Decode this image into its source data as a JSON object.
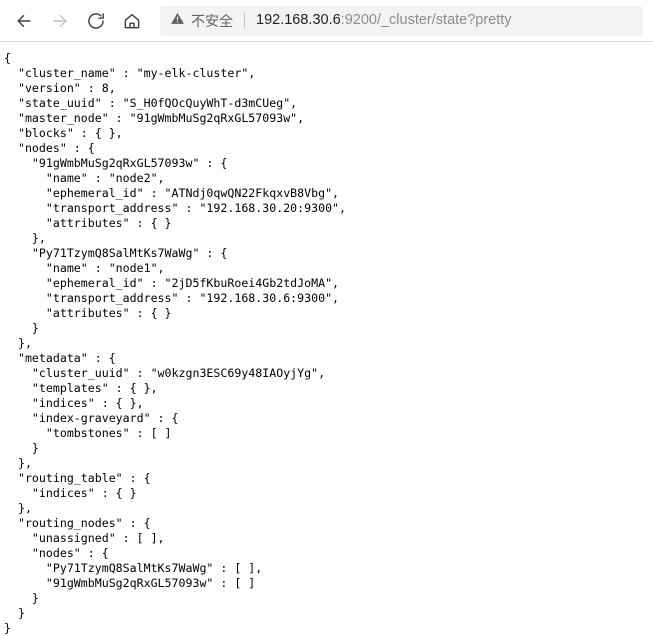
{
  "browser": {
    "nav": {
      "back_label": "Back",
      "back_icon": "arrow-left-icon",
      "forward_label": "Forward",
      "forward_icon": "arrow-right-icon",
      "reload_label": "Reload",
      "reload_icon": "reload-icon",
      "home_label": "Home",
      "home_icon": "home-icon"
    },
    "omnibox": {
      "security_icon": "warning-triangle-icon",
      "security_text": "不安全",
      "url_host": "192.168.30.6",
      "url_path": ":9200/_cluster/state?pretty",
      "url_full": "192.168.30.6:9200/_cluster/state?pretty"
    },
    "colors": {
      "omnibox_bg": "#f1f3f4",
      "toolbar_border": "#dcdcdc",
      "security_text": "#5f6368",
      "url_host": "#202124",
      "url_path": "#8a8d91",
      "icon_active": "#3c4043",
      "icon_disabled": "#bdc1c6",
      "page_bg": "#ffffff",
      "json_text": "#000000"
    }
  },
  "response": {
    "cluster_name": "my-elk-cluster",
    "version": 8,
    "state_uuid": "S_H0fQOcQuyWhT-d3mCUeg",
    "master_node": "91gWmbMuSg2qRxGL57093w",
    "blocks": {},
    "nodes": {
      "91gWmbMuSg2qRxGL57093w": {
        "name": "node2",
        "ephemeral_id": "ATNdj0qwQN22FkqxvB8Vbg",
        "transport_address": "192.168.30.20:9300",
        "attributes": {}
      },
      "Py71TzymQ8SalMtKs7WaWg": {
        "name": "node1",
        "ephemeral_id": "2jD5fKbuRoei4Gb2tdJoMA",
        "transport_address": "192.168.30.6:9300",
        "attributes": {}
      }
    },
    "metadata": {
      "cluster_uuid": "w0kzgn3ESC69y48IAOyjYg",
      "templates": {},
      "indices": {},
      "index-graveyard": {
        "tombstones": []
      }
    },
    "routing_table": {
      "indices": {}
    },
    "routing_nodes": {
      "unassigned": [],
      "nodes": {
        "Py71TzymQ8SalMtKs7WaWg": [],
        "91gWmbMuSg2qRxGL57093w": []
      }
    }
  },
  "response_text": "{\n  \"cluster_name\" : \"my-elk-cluster\",\n  \"version\" : 8,\n  \"state_uuid\" : \"S_H0fQOcQuyWhT-d3mCUeg\",\n  \"master_node\" : \"91gWmbMuSg2qRxGL57093w\",\n  \"blocks\" : { },\n  \"nodes\" : {\n    \"91gWmbMuSg2qRxGL57093w\" : {\n      \"name\" : \"node2\",\n      \"ephemeral_id\" : \"ATNdj0qwQN22FkqxvB8Vbg\",\n      \"transport_address\" : \"192.168.30.20:9300\",\n      \"attributes\" : { }\n    },\n    \"Py71TzymQ8SalMtKs7WaWg\" : {\n      \"name\" : \"node1\",\n      \"ephemeral_id\" : \"2jD5fKbuRoei4Gb2tdJoMA\",\n      \"transport_address\" : \"192.168.30.6:9300\",\n      \"attributes\" : { }\n    }\n  },\n  \"metadata\" : {\n    \"cluster_uuid\" : \"w0kzgn3ESC69y48IAOyjYg\",\n    \"templates\" : { },\n    \"indices\" : { },\n    \"index-graveyard\" : {\n      \"tombstones\" : [ ]\n    }\n  },\n  \"routing_table\" : {\n    \"indices\" : { }\n  },\n  \"routing_nodes\" : {\n    \"unassigned\" : [ ],\n    \"nodes\" : {\n      \"Py71TzymQ8SalMtKs7WaWg\" : [ ],\n      \"91gWmbMuSg2qRxGL57093w\" : [ ]\n    }\n  }\n}"
}
